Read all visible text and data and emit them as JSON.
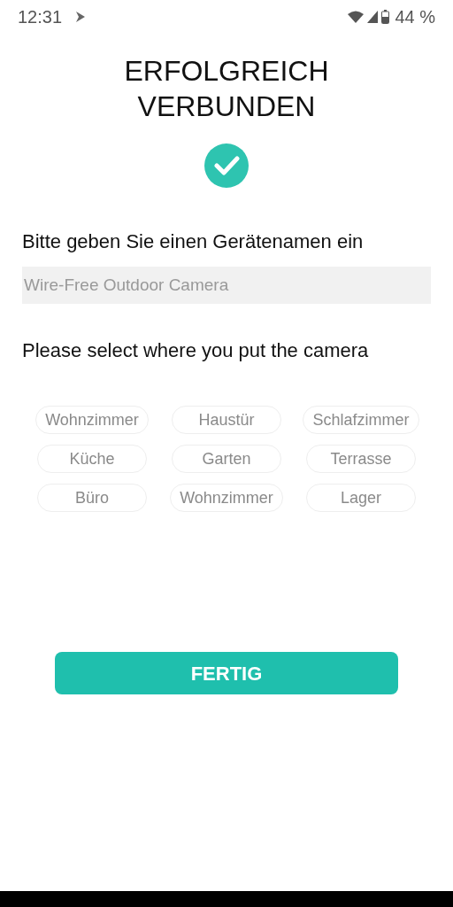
{
  "status_bar": {
    "time": "12:31",
    "battery": "44 %"
  },
  "title": "ERFOLGREICH VERBUNDEN",
  "name_prompt": "Bitte geben Sie einen Gerätenamen ein",
  "name_field": {
    "placeholder": "Wire-Free Outdoor Camera"
  },
  "location_prompt": "Please select where you put the camera",
  "locations": [
    {
      "label": "Wohnzimmer",
      "selected": false
    },
    {
      "label": "Haustür",
      "selected": false
    },
    {
      "label": "Schlafzimmer",
      "selected": false
    },
    {
      "label": "Küche",
      "selected": false
    },
    {
      "label": "Garten",
      "selected": false
    },
    {
      "label": "Terrasse",
      "selected": false
    },
    {
      "label": "Büro",
      "selected": false
    },
    {
      "label": "Wohnzimmer",
      "selected": false
    },
    {
      "label": "Lager",
      "selected": false
    }
  ],
  "done_button": "FERTIG"
}
